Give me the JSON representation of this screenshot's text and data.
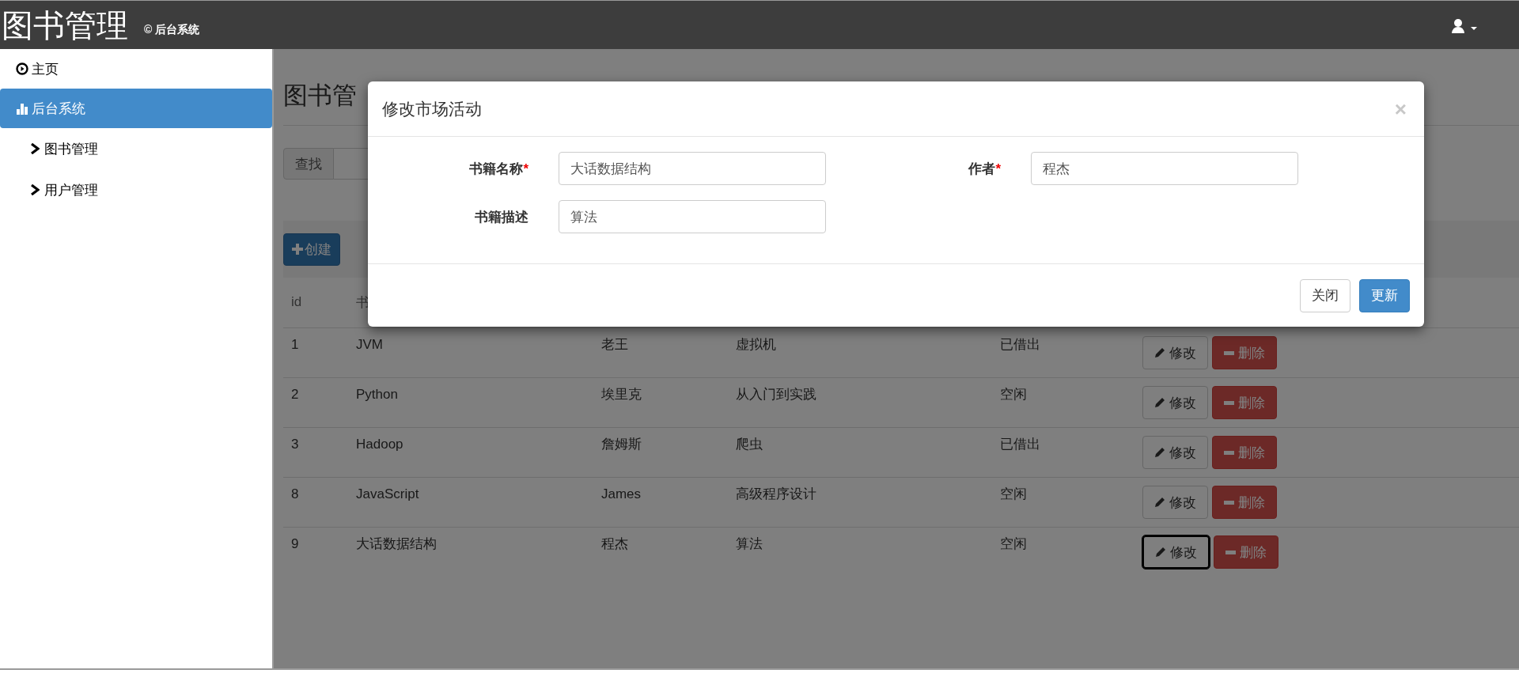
{
  "header": {
    "title": "图书管理",
    "subtitle": "© 后台系统"
  },
  "sidebar": {
    "items": [
      {
        "label": "主页",
        "selected": false
      },
      {
        "label": "后台系统",
        "selected": true,
        "children": [
          {
            "label": "图书管理",
            "selected": false
          },
          {
            "label": "用户管理",
            "selected": false
          }
        ]
      }
    ]
  },
  "main": {
    "title": "图书管",
    "search": {
      "button": "查找"
    },
    "create_button": "创建",
    "table": {
      "columns": [
        "id",
        "书"
      ],
      "rows": [
        {
          "id": "1",
          "name": "JVM",
          "author": "老王",
          "description": "虚拟机",
          "status": "已借出",
          "edit": "修改",
          "delete": "删除",
          "edit_focused": false
        },
        {
          "id": "2",
          "name": "Python",
          "author": "埃里克",
          "description": "从入门到实践",
          "status": "空闲",
          "edit": "修改",
          "delete": "删除",
          "edit_focused": false
        },
        {
          "id": "3",
          "name": "Hadoop",
          "author": "詹姆斯",
          "description": "爬虫",
          "status": "已借出",
          "edit": "修改",
          "delete": "删除",
          "edit_focused": false
        },
        {
          "id": "8",
          "name": "JavaScript",
          "author": "James",
          "description": "高级程序设计",
          "status": "空闲",
          "edit": "修改",
          "delete": "删除",
          "edit_focused": false
        },
        {
          "id": "9",
          "name": "大话数据结构",
          "author": "程杰",
          "description": "算法",
          "status": "空闲",
          "edit": "修改",
          "delete": "删除",
          "edit_focused": true
        }
      ]
    }
  },
  "modal": {
    "title": "修改市场活动",
    "close": "×",
    "required_mark": "*",
    "fields": [
      {
        "label": "书籍名称",
        "required": true,
        "value": "大话数据结构"
      },
      {
        "label": "作者",
        "required": true,
        "value": "程杰"
      },
      {
        "label": "书籍描述",
        "required": false,
        "value": "算法"
      }
    ],
    "buttons": [
      {
        "label": "关闭",
        "kind": "default"
      },
      {
        "label": "更新",
        "kind": "primary"
      }
    ]
  }
}
